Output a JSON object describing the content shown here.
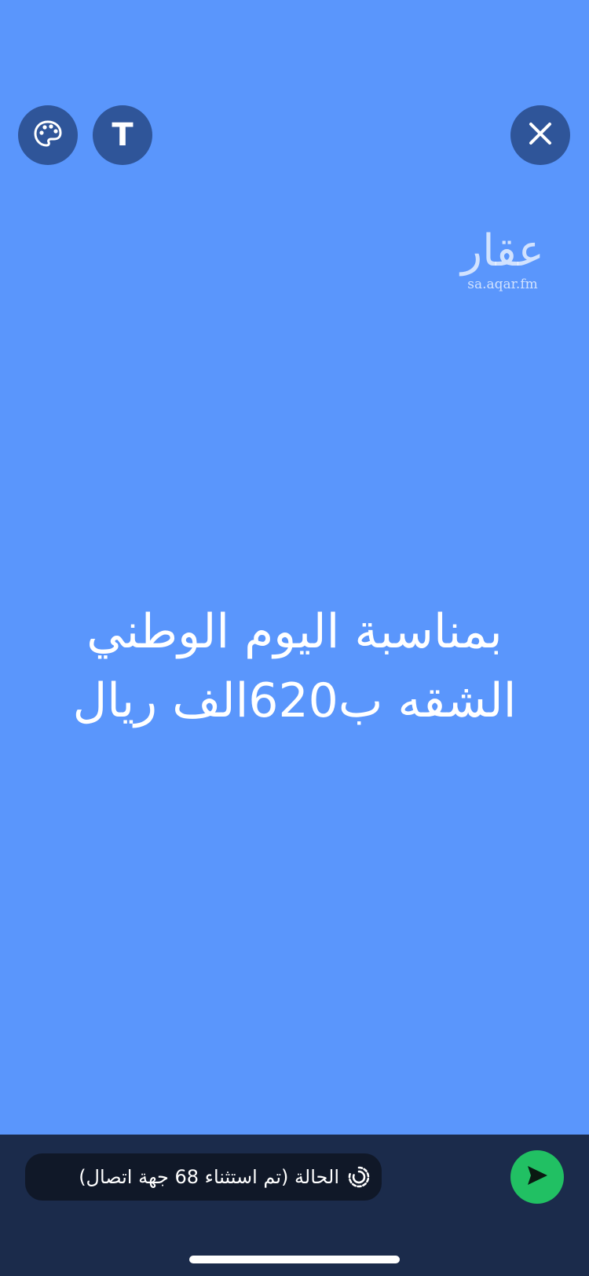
{
  "toolbar": {
    "palette_icon": "palette-icon",
    "text_tool_label": "T",
    "close_icon": "close-icon"
  },
  "watermark": {
    "logo_text": "عقار",
    "url": "sa.aqar.fm"
  },
  "story": {
    "line1": "بمناسبة اليوم الوطني",
    "line2": "الشقه ب620الف ريال"
  },
  "composer": {
    "status_text": "الحالة (تم استثناء 68 جهة اتصال)",
    "status_icon": "status-ring-icon",
    "send_icon": "send-icon"
  },
  "colors": {
    "background": "#5a96fc",
    "toolbar_button": "#2f5599",
    "bottom_bar": "#1b2b4b",
    "status_pill": "#101828",
    "send_button": "#21c063",
    "text": "#ffffff"
  }
}
